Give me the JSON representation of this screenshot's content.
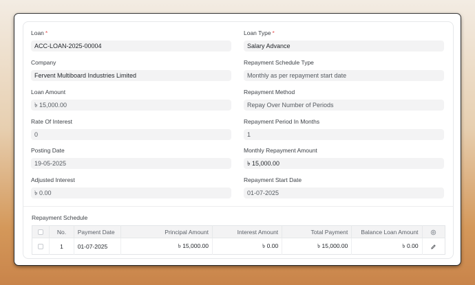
{
  "form": {
    "loan": {
      "label": "Loan",
      "value": "ACC-LOAN-2025-00004"
    },
    "loan_type": {
      "label": "Loan Type",
      "value": "Salary Advance"
    },
    "company": {
      "label": "Company",
      "value": "Fervent Multiboard Industries Limited"
    },
    "repayment_schedule_type": {
      "label": "Repayment Schedule Type",
      "value": "Monthly as per repayment start date"
    },
    "loan_amount": {
      "label": "Loan Amount",
      "value": "৳ 15,000.00"
    },
    "repayment_method": {
      "label": "Repayment Method",
      "value": "Repay Over Number of Periods"
    },
    "rate_of_interest": {
      "label": "Rate Of Interest",
      "value": "0"
    },
    "repayment_period": {
      "label": "Repayment Period In Months",
      "value": "1"
    },
    "posting_date": {
      "label": "Posting Date",
      "value": "19-05-2025"
    },
    "monthly_repayment_amount": {
      "label": "Monthly Repayment Amount",
      "value": "৳ 15,000.00"
    },
    "adjusted_interest": {
      "label": "Adjusted Interest",
      "value": "৳ 0.00"
    },
    "repayment_start_date": {
      "label": "Repayment Start Date",
      "value": "01-07-2025"
    },
    "required_marker": "*"
  },
  "schedule": {
    "title": "Repayment Schedule",
    "columns": {
      "no": "No.",
      "payment_date": "Payment Date",
      "principal_amount": "Principal Amount",
      "interest_amount": "Interest Amount",
      "total_payment": "Total Payment",
      "balance_loan_amount": "Balance Loan Amount"
    },
    "rows": [
      {
        "no": "1",
        "payment_date": "01-07-2025",
        "principal_amount": "৳ 15,000.00",
        "interest_amount": "৳ 0.00",
        "total_payment": "৳ 15,000.00",
        "balance_loan_amount": "৳ 0.00"
      }
    ],
    "icons": {
      "settings": "gear-icon",
      "edit": "pencil-icon"
    }
  }
}
